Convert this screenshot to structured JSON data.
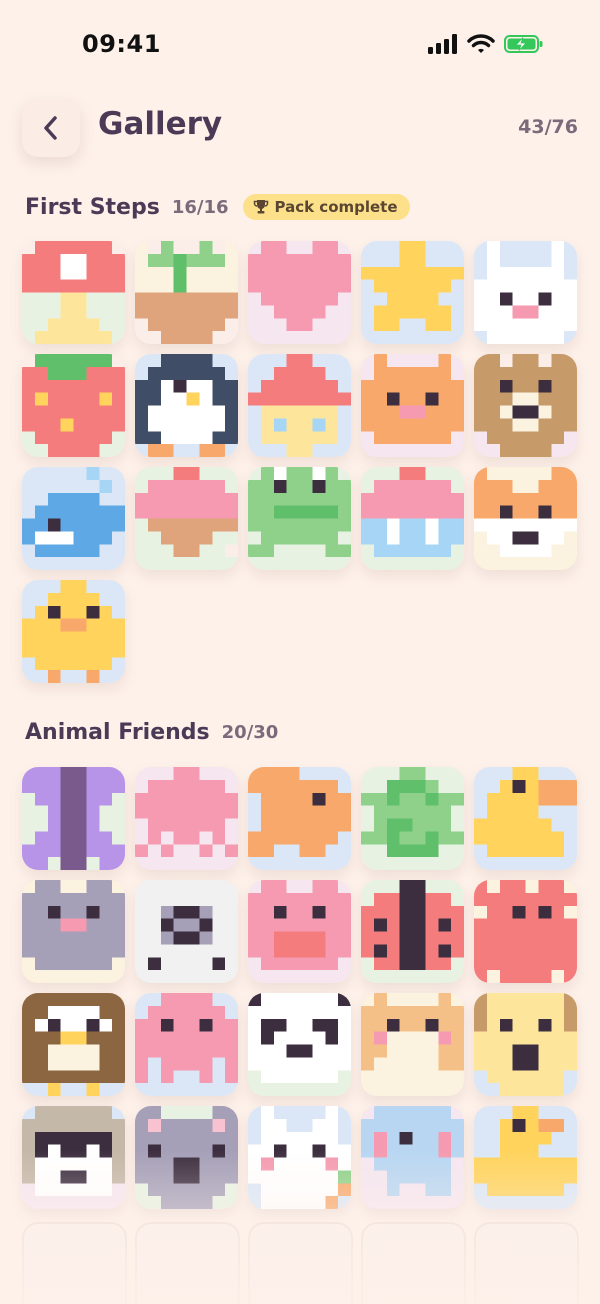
{
  "status_bar": {
    "time": "09:41"
  },
  "header": {
    "title": "Gallery",
    "progress": "43/76"
  },
  "sections": [
    {
      "title": "First Steps",
      "count": "16/16",
      "badge": "Pack complete",
      "tiles": [
        "mushroom",
        "sprout-pot",
        "heart",
        "star",
        "bunny",
        "strawberry",
        "penguin",
        "gnome",
        "cat",
        "bear",
        "whale",
        "ice-cream",
        "frog",
        "cupcake",
        "fox",
        "chick"
      ]
    },
    {
      "title": "Animal Friends",
      "count": "20/30",
      "tiles": [
        "butterfly",
        "jellyfish",
        "fish",
        "turtle",
        "toucan",
        "mouse",
        "sheep",
        "pig",
        "ladybug",
        "crab",
        "owl",
        "octopus",
        "panda",
        "hamster",
        "dog",
        "raccoon",
        "koala",
        "rabbit",
        "elephant",
        "duck"
      ]
    }
  ],
  "icons": {
    "back": "chevron-left-icon",
    "trophy": "trophy-icon",
    "signal": "signal-icon",
    "wifi": "wifi-icon",
    "battery": "battery-charging-icon"
  },
  "colors": {
    "background": "#fdf1ea",
    "badge": "#fde08a",
    "battery": "#34c759"
  }
}
